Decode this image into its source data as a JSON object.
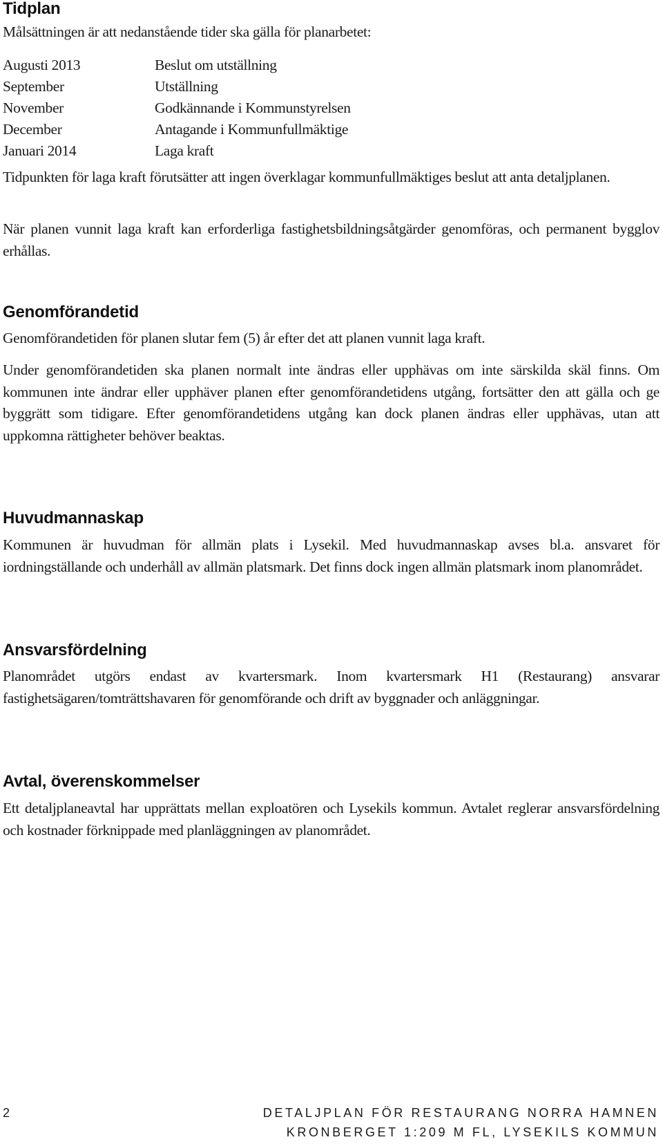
{
  "sections": {
    "tidplan": {
      "heading": "Tidplan",
      "intro": "Målsättningen är att nedanstående tider ska gälla för planarbetet:",
      "schedule": [
        {
          "date": "Augusti 2013",
          "event": "Beslut om utställning"
        },
        {
          "date": "September",
          "event": "Utställning"
        },
        {
          "date": "November",
          "event": "Godkännande i Kommunstyrelsen"
        },
        {
          "date": "December",
          "event": "Antagande i Kommunfullmäktige"
        },
        {
          "date": "Januari 2014",
          "event": "Laga kraft"
        }
      ],
      "paragraphs": [
        "Tidpunkten för laga kraft förutsätter att ingen överklagar kommunfullmäktiges beslut att anta detaljplanen.",
        "När planen vunnit laga kraft kan erforderliga fastighetsbildningsåtgärder genomföras, och permanent bygglov erhållas."
      ]
    },
    "genomforandetid": {
      "heading": "Genomförandetid",
      "paragraphs": [
        "Genomförandetiden för planen slutar fem (5) år efter det att planen vunnit laga kraft.",
        "Under genomförandetiden ska planen normalt inte ändras eller upphävas om inte sär­skilda skäl finns. Om kommunen inte ändrar eller upphäver planen efter genomförande­tidens utgång, fortsätter den att gälla och ge byggrätt som tidigare. Efter genomförande­tidens utgång kan dock planen ändras eller upphävas, utan att uppkomna rättigheter be­höver beaktas."
      ]
    },
    "huvudmannaskap": {
      "heading": "Huvudmannaskap",
      "paragraphs": [
        "Kommunen är huvudman för allmän plats i Lysekil. Med huvudmannaskap avses bl.a. ansvaret för iordningställande och underhåll av allmän platsmark. Det finns dock ingen allmän platsmark inom planområdet."
      ]
    },
    "ansvarsfordelning": {
      "heading": "Ansvarsfördelning",
      "paragraphs": [
        "Planområdet utgörs endast av kvartersmark. Inom kvartersmark H1 (Restaurang) ansva­rar fastighetsägaren/tomträttshavaren för genomförande och drift av byggnader och an­läggningar."
      ]
    },
    "avtal": {
      "heading": "Avtal, överenskommelser",
      "paragraphs": [
        "Ett detaljplaneavtal har upprättats mellan exploatören och Lysekils kommun. Avtalet reglerar ansvarsfördelning och kostnader förknippade med planläggningen av plan­området."
      ]
    }
  },
  "footer": {
    "page_number": "2",
    "title_line1": "DETALJPLAN FÖR RESTAURANG NORRA HAMNEN",
    "title_line2": "KRONBERGET 1:209 M FL, LYSEKILS KOMMUN"
  }
}
